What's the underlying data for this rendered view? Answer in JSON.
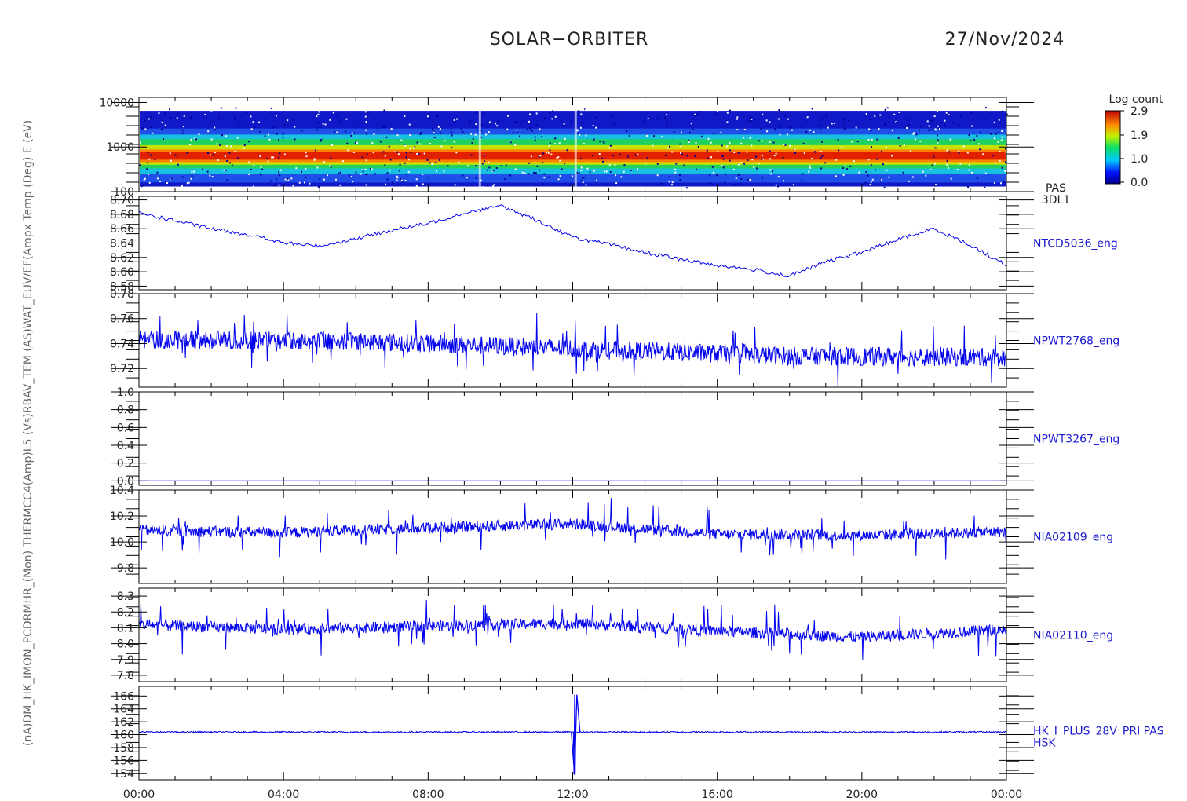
{
  "header": {
    "title": "SOLAR−ORBITER",
    "date": "27/Nov/2024"
  },
  "colorbar": {
    "label": "Log count",
    "ticks": [
      "2.9",
      "1.9",
      "1.0",
      "0.0"
    ]
  },
  "colors": {
    "trace": "#0000ee",
    "frame": "#000000"
  },
  "ylabel_stack": "(nA)DM_HK_IMON_PCDRMHR_(Mon) THERMCC4(Amp)L5 (Vs)RBAV_TEM (AS)WAT_EUV/EF(Ampx Temp (Deg) E (eV)",
  "chart_data": [
    {
      "type": "heatmap",
      "ylabel": "E (eV)",
      "yscale": "log",
      "ylim": [
        100,
        13000
      ],
      "yticks": [
        "10000",
        "1000",
        "100"
      ],
      "xticks": [
        "00:00",
        "04:00",
        "08:00",
        "12:00",
        "16:00",
        "20:00",
        "00:00"
      ],
      "xlim_hours": [
        0,
        24
      ],
      "color_range": [
        0.0,
        2.9
      ],
      "band_center_eV": 620,
      "side_labels": [
        "PAS",
        "3DL1"
      ]
    },
    {
      "type": "line",
      "ylabel": "Temp (Deg)",
      "ylim": [
        8.575,
        8.705
      ],
      "yticks": [
        "8.70",
        "8.68",
        "8.66",
        "8.64",
        "8.62",
        "8.60",
        "8.58"
      ],
      "x_hours": [
        0,
        1,
        2,
        3,
        4,
        5,
        6,
        7,
        8,
        9,
        10,
        11,
        12,
        13,
        14,
        15,
        16,
        17,
        18,
        19,
        20,
        21,
        22,
        23,
        24
      ],
      "values": [
        8.682,
        8.671,
        8.66,
        8.652,
        8.64,
        8.636,
        8.646,
        8.658,
        8.667,
        8.682,
        8.692,
        8.672,
        8.648,
        8.638,
        8.627,
        8.617,
        8.609,
        8.603,
        8.594,
        8.614,
        8.627,
        8.645,
        8.66,
        8.637,
        8.609
      ],
      "side_labels": [
        "NTCD5036_eng"
      ]
    },
    {
      "type": "line",
      "ylabel": "",
      "ylim": [
        0.705,
        0.78
      ],
      "yticks": [
        "0.78",
        "0.76",
        "0.74",
        "0.72"
      ],
      "x_hours": [
        0,
        6,
        12,
        18,
        24
      ],
      "values": [
        0.743,
        0.742,
        0.736,
        0.73,
        0.729
      ],
      "side_labels": [
        "NPWT2768_eng"
      ]
    },
    {
      "type": "line",
      "ylabel": "",
      "ylim": [
        -0.05,
        1.0
      ],
      "yticks": [
        "1.0",
        "0.8",
        "0.6",
        "0.4",
        "0.2",
        "0.0"
      ],
      "x_hours": [
        0,
        24
      ],
      "values": [
        0.0,
        0.0
      ],
      "side_labels": [
        "NPWT3267_eng"
      ]
    },
    {
      "type": "line",
      "ylabel": "",
      "ylim": [
        9.68,
        10.4
      ],
      "yticks": [
        "10.4",
        "10.2",
        "10.0",
        "9.8"
      ],
      "x_hours": [
        0,
        4,
        8,
        12,
        16,
        20,
        24
      ],
      "values": [
        10.09,
        10.07,
        10.11,
        10.14,
        10.06,
        10.05,
        10.08
      ],
      "side_labels": [
        "NIA02109_eng"
      ]
    },
    {
      "type": "line",
      "ylabel": "",
      "ylim": [
        7.76,
        8.35
      ],
      "yticks": [
        "8.3",
        "8.2",
        "8.1",
        "8.0",
        "7.9",
        "7.8"
      ],
      "x_hours": [
        0,
        4,
        8,
        12,
        16,
        20,
        24
      ],
      "values": [
        8.12,
        8.09,
        8.11,
        8.13,
        8.08,
        8.04,
        8.09
      ],
      "side_labels": [
        "NIA02110_eng"
      ]
    },
    {
      "type": "line",
      "ylabel": "(nA)",
      "ylim": [
        153,
        167.5
      ],
      "yticks": [
        "166",
        "164",
        "162",
        "160",
        "158",
        "156",
        "154"
      ],
      "x_hours": [
        0,
        24
      ],
      "values": [
        160.4,
        160.4
      ],
      "spike": {
        "x_hour": 12.05,
        "min": 153.8,
        "max": 166.2
      },
      "side_labels": [
        "HK_I_PLUS_28V_PRI PAS",
        "HSK"
      ]
    }
  ]
}
